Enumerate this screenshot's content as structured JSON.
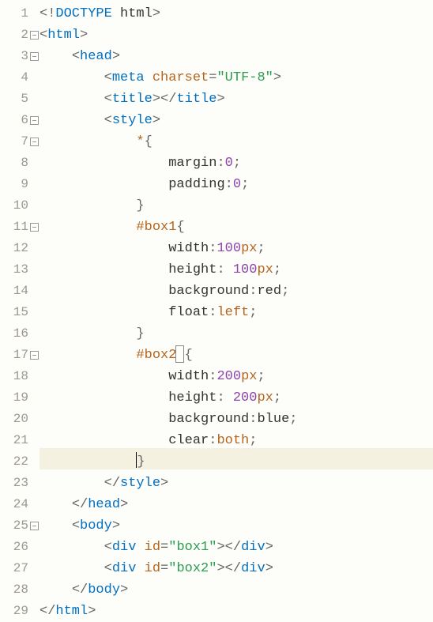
{
  "editor": {
    "highlighted_line": 22,
    "line_count": 29,
    "fold_markers_at": [
      2,
      3,
      6,
      7,
      11,
      17,
      25
    ],
    "lines": [
      {
        "n": 1,
        "segs": [
          {
            "c": "punct",
            "t": "<!"
          },
          {
            "c": "kw",
            "t": "DOCTYPE"
          },
          {
            "c": "text",
            "t": " html"
          },
          {
            "c": "punct",
            "t": ">"
          }
        ]
      },
      {
        "n": 2,
        "segs": [
          {
            "c": "punct",
            "t": "<"
          },
          {
            "c": "tag",
            "t": "html"
          },
          {
            "c": "punct",
            "t": ">"
          }
        ]
      },
      {
        "n": 3,
        "indent": 4,
        "segs": [
          {
            "c": "punct",
            "t": "<"
          },
          {
            "c": "tag",
            "t": "head"
          },
          {
            "c": "punct",
            "t": ">"
          }
        ]
      },
      {
        "n": 4,
        "indent": 8,
        "segs": [
          {
            "c": "punct",
            "t": "<"
          },
          {
            "c": "tag",
            "t": "meta"
          },
          {
            "c": "text",
            "t": " "
          },
          {
            "c": "attr",
            "t": "charset"
          },
          {
            "c": "punct",
            "t": "="
          },
          {
            "c": "str",
            "t": "\"UTF-8\""
          },
          {
            "c": "punct",
            "t": ">"
          }
        ]
      },
      {
        "n": 5,
        "indent": 8,
        "segs": [
          {
            "c": "punct",
            "t": "<"
          },
          {
            "c": "tag",
            "t": "title"
          },
          {
            "c": "punct",
            "t": "></"
          },
          {
            "c": "tag",
            "t": "title"
          },
          {
            "c": "punct",
            "t": ">"
          }
        ]
      },
      {
        "n": 6,
        "indent": 8,
        "segs": [
          {
            "c": "punct",
            "t": "<"
          },
          {
            "c": "tag",
            "t": "style"
          },
          {
            "c": "punct",
            "t": ">"
          }
        ]
      },
      {
        "n": 7,
        "indent": 12,
        "segs": [
          {
            "c": "sel",
            "t": "*"
          },
          {
            "c": "punct",
            "t": "{"
          }
        ]
      },
      {
        "n": 8,
        "indent": 16,
        "segs": [
          {
            "c": "prop",
            "t": "margin"
          },
          {
            "c": "punct",
            "t": ":"
          },
          {
            "c": "num",
            "t": "0"
          },
          {
            "c": "punct",
            "t": ";"
          }
        ]
      },
      {
        "n": 9,
        "indent": 16,
        "segs": [
          {
            "c": "prop",
            "t": "padding"
          },
          {
            "c": "punct",
            "t": ":"
          },
          {
            "c": "num",
            "t": "0"
          },
          {
            "c": "punct",
            "t": ";"
          }
        ]
      },
      {
        "n": 10,
        "indent": 12,
        "segs": [
          {
            "c": "punct",
            "t": "}"
          }
        ]
      },
      {
        "n": 11,
        "indent": 12,
        "segs": [
          {
            "c": "sel",
            "t": "#box1"
          },
          {
            "c": "punct",
            "t": "{"
          }
        ]
      },
      {
        "n": 12,
        "indent": 16,
        "segs": [
          {
            "c": "prop",
            "t": "width"
          },
          {
            "c": "punct",
            "t": ":"
          },
          {
            "c": "num",
            "t": "100"
          },
          {
            "c": "unit",
            "t": "px"
          },
          {
            "c": "punct",
            "t": ";"
          }
        ]
      },
      {
        "n": 13,
        "indent": 16,
        "segs": [
          {
            "c": "prop",
            "t": "height"
          },
          {
            "c": "punct",
            "t": ": "
          },
          {
            "c": "num",
            "t": "100"
          },
          {
            "c": "unit",
            "t": "px"
          },
          {
            "c": "punct",
            "t": ";"
          }
        ]
      },
      {
        "n": 14,
        "indent": 16,
        "segs": [
          {
            "c": "prop",
            "t": "background"
          },
          {
            "c": "punct",
            "t": ":"
          },
          {
            "c": "text",
            "t": "red"
          },
          {
            "c": "punct",
            "t": ";"
          }
        ]
      },
      {
        "n": 15,
        "indent": 16,
        "segs": [
          {
            "c": "prop",
            "t": "float"
          },
          {
            "c": "punct",
            "t": ":"
          },
          {
            "c": "val",
            "t": "left"
          },
          {
            "c": "punct",
            "t": ";"
          }
        ]
      },
      {
        "n": 16,
        "indent": 12,
        "segs": [
          {
            "c": "punct",
            "t": "}"
          }
        ]
      },
      {
        "n": 17,
        "indent": 12,
        "segs": [
          {
            "c": "sel",
            "t": "#box2"
          },
          {
            "cursorbox": true
          },
          {
            "c": "punct",
            "t": "{"
          }
        ]
      },
      {
        "n": 18,
        "indent": 16,
        "segs": [
          {
            "c": "prop",
            "t": "width"
          },
          {
            "c": "punct",
            "t": ":"
          },
          {
            "c": "num",
            "t": "200"
          },
          {
            "c": "unit",
            "t": "px"
          },
          {
            "c": "punct",
            "t": ";"
          }
        ]
      },
      {
        "n": 19,
        "indent": 16,
        "segs": [
          {
            "c": "prop",
            "t": "height"
          },
          {
            "c": "punct",
            "t": ": "
          },
          {
            "c": "num",
            "t": "200"
          },
          {
            "c": "unit",
            "t": "px"
          },
          {
            "c": "punct",
            "t": ";"
          }
        ]
      },
      {
        "n": 20,
        "indent": 16,
        "segs": [
          {
            "c": "prop",
            "t": "background"
          },
          {
            "c": "punct",
            "t": ":"
          },
          {
            "c": "text",
            "t": "blue"
          },
          {
            "c": "punct",
            "t": ";"
          }
        ]
      },
      {
        "n": 21,
        "indent": 16,
        "segs": [
          {
            "c": "prop",
            "t": "clear"
          },
          {
            "c": "punct",
            "t": ":"
          },
          {
            "c": "val",
            "t": "both"
          },
          {
            "c": "punct",
            "t": ";"
          }
        ]
      },
      {
        "n": 22,
        "indent": 12,
        "segs": [
          {
            "caret": true
          },
          {
            "c": "punct",
            "t": "}"
          }
        ]
      },
      {
        "n": 23,
        "indent": 8,
        "segs": [
          {
            "c": "punct",
            "t": "</"
          },
          {
            "c": "tag",
            "t": "style"
          },
          {
            "c": "punct",
            "t": ">"
          }
        ]
      },
      {
        "n": 24,
        "indent": 4,
        "segs": [
          {
            "c": "punct",
            "t": "</"
          },
          {
            "c": "tag",
            "t": "head"
          },
          {
            "c": "punct",
            "t": ">"
          }
        ]
      },
      {
        "n": 25,
        "indent": 4,
        "segs": [
          {
            "c": "punct",
            "t": "<"
          },
          {
            "c": "tag",
            "t": "body"
          },
          {
            "c": "punct",
            "t": ">"
          }
        ]
      },
      {
        "n": 26,
        "indent": 8,
        "segs": [
          {
            "c": "punct",
            "t": "<"
          },
          {
            "c": "tag",
            "t": "div"
          },
          {
            "c": "text",
            "t": " "
          },
          {
            "c": "attr",
            "t": "id"
          },
          {
            "c": "punct",
            "t": "="
          },
          {
            "c": "str",
            "t": "\"box1\""
          },
          {
            "c": "punct",
            "t": "></"
          },
          {
            "c": "tag",
            "t": "div"
          },
          {
            "c": "punct",
            "t": ">"
          }
        ]
      },
      {
        "n": 27,
        "indent": 8,
        "segs": [
          {
            "c": "punct",
            "t": "<"
          },
          {
            "c": "tag",
            "t": "div"
          },
          {
            "c": "text",
            "t": " "
          },
          {
            "c": "attr",
            "t": "id"
          },
          {
            "c": "punct",
            "t": "="
          },
          {
            "c": "str",
            "t": "\"box2\""
          },
          {
            "c": "punct",
            "t": "></"
          },
          {
            "c": "tag",
            "t": "div"
          },
          {
            "c": "punct",
            "t": ">"
          }
        ]
      },
      {
        "n": 28,
        "indent": 4,
        "segs": [
          {
            "c": "punct",
            "t": "</"
          },
          {
            "c": "tag",
            "t": "body"
          },
          {
            "c": "punct",
            "t": ">"
          }
        ]
      },
      {
        "n": 29,
        "segs": [
          {
            "c": "punct",
            "t": "</"
          },
          {
            "c": "tag",
            "t": "html"
          },
          {
            "c": "punct",
            "t": ">"
          }
        ]
      }
    ]
  }
}
